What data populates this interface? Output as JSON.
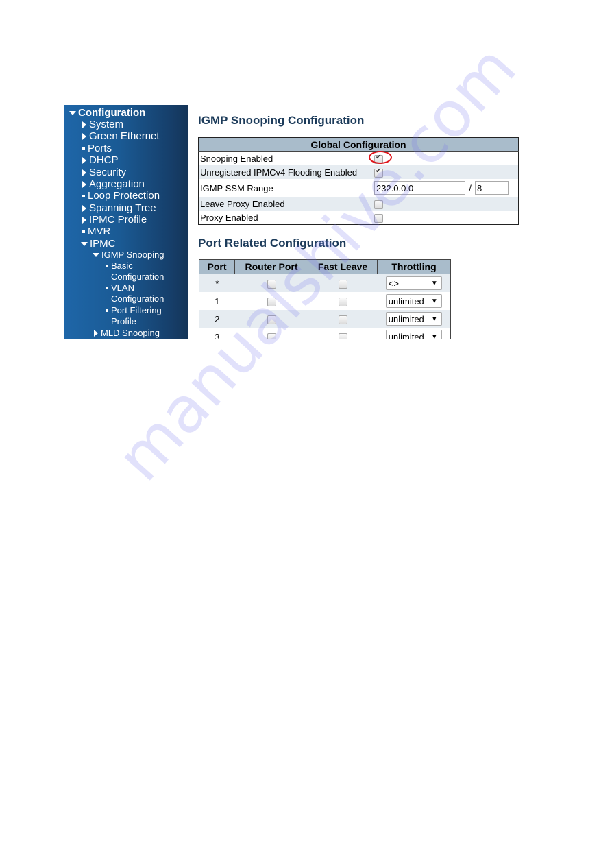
{
  "sidebar": {
    "items": [
      {
        "label": "Configuration",
        "icon": "caret-down",
        "level": 0
      },
      {
        "label": "System",
        "icon": "caret-right",
        "level": 1
      },
      {
        "label": "Green Ethernet",
        "icon": "caret-right",
        "level": 1
      },
      {
        "label": "Ports",
        "icon": "bullet",
        "level": 1
      },
      {
        "label": "DHCP",
        "icon": "caret-right",
        "level": 1
      },
      {
        "label": "Security",
        "icon": "caret-right",
        "level": 1
      },
      {
        "label": "Aggregation",
        "icon": "caret-right",
        "level": 1
      },
      {
        "label": "Loop Protection",
        "icon": "bullet",
        "level": 1
      },
      {
        "label": "Spanning Tree",
        "icon": "caret-right",
        "level": 1
      },
      {
        "label": "IPMC Profile",
        "icon": "caret-right",
        "level": 1
      },
      {
        "label": "MVR",
        "icon": "bullet",
        "level": 1
      },
      {
        "label": "IPMC",
        "icon": "caret-down",
        "level": 1
      },
      {
        "label": "IGMP Snooping",
        "icon": "caret-down",
        "level": 2
      },
      {
        "label_line1": "Basic",
        "label_line2": "Configuration",
        "icon": "bullet",
        "level": 3
      },
      {
        "label_line1": "VLAN",
        "label_line2": "Configuration",
        "icon": "bullet",
        "level": 3
      },
      {
        "label_line1": "Port Filtering",
        "label_line2": "Profile",
        "icon": "bullet",
        "level": 3
      },
      {
        "label": "MLD Snooping",
        "icon": "caret-right",
        "level": 2
      }
    ]
  },
  "main": {
    "title": "IGMP Snooping Configuration",
    "global": {
      "header": "Global Configuration",
      "rows": [
        {
          "label": "Snooping Enabled",
          "checked": true,
          "highlighted": true
        },
        {
          "label": "Unregistered IPMCv4 Flooding Enabled",
          "checked": true
        },
        {
          "label": "IGMP SSM Range",
          "address": "232.0.0.0",
          "separator": "/",
          "mask": "8"
        },
        {
          "label": "Leave Proxy Enabled",
          "checked": false
        },
        {
          "label": "Proxy Enabled",
          "checked": false
        }
      ]
    },
    "port_section_title": "Port Related Configuration",
    "port_table": {
      "headers": [
        "Port",
        "Router Port",
        "Fast Leave",
        "Throttling"
      ],
      "rows": [
        {
          "port": "*",
          "router_port": false,
          "fast_leave": false,
          "throttling": "<>"
        },
        {
          "port": "1",
          "router_port": false,
          "fast_leave": false,
          "throttling": "unlimited"
        },
        {
          "port": "2",
          "router_port": false,
          "fast_leave": false,
          "throttling": "unlimited"
        },
        {
          "port": "3",
          "router_port": false,
          "fast_leave": false,
          "throttling": "unlimited"
        }
      ],
      "dropdown_arrow": "▼"
    }
  },
  "watermark": "manualshive.com",
  "colors": {
    "sidebar_start": "#1e66a8",
    "sidebar_end": "#143457",
    "header_bg": "#a9bccb",
    "row_alt_bg": "#e6ecf1",
    "title_color": "#1c3b5a",
    "highlight_ring": "#e0151b"
  }
}
